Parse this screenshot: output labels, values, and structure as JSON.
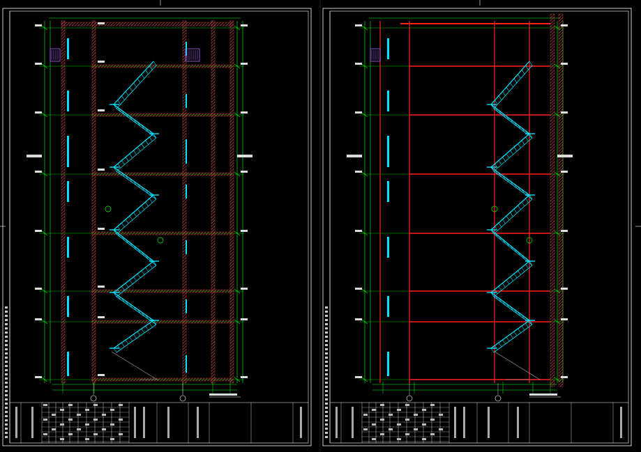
{
  "colors": {
    "background": "#000000",
    "frame": "#ffffff",
    "dimension": "#00ff00",
    "stair": "#00e5ff",
    "wall_hatch": "#ff5a5a",
    "wall_line": "#ff2020",
    "grid_axis": "#ffffff",
    "text": "#ffffff",
    "window": "#00e5ff",
    "railing": "#ff8080"
  },
  "sheets": [
    {
      "id": "left-sheet",
      "variant": "hatched-walls",
      "axis_labels": [
        "",
        ""
      ]
    },
    {
      "id": "right-sheet",
      "variant": "red-slabs",
      "axis_labels": [
        "",
        ""
      ]
    }
  ]
}
